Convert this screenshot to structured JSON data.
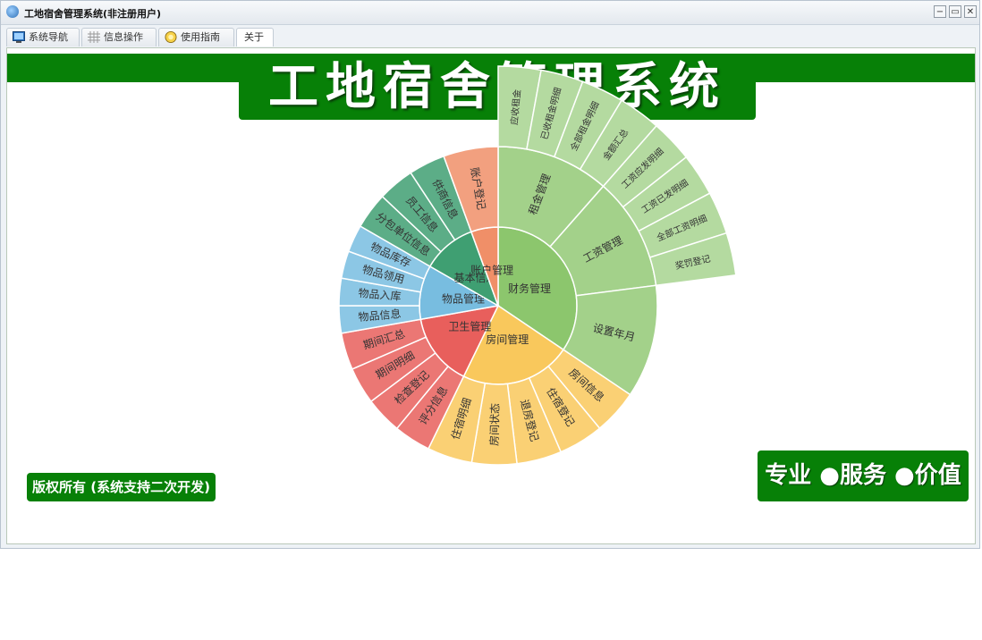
{
  "window": {
    "title": "工地宿舍管理系统(非注册用户)",
    "controls": {
      "minimize": "−",
      "restore": "▭",
      "close": "✕"
    }
  },
  "tabs": [
    {
      "label": "系统导航",
      "icon": "navigation-icon"
    },
    {
      "label": "信息操作",
      "icon": "grid-icon"
    },
    {
      "label": "使用指南",
      "icon": "guide-icon"
    },
    {
      "label": "关于",
      "icon": ""
    }
  ],
  "banner": {
    "title": "工地宿舍管理系统"
  },
  "footer": {
    "copyright": "版权所有 (系统支持二次开发)",
    "slogan": "专业 ●服务 ●价值"
  },
  "colors": {
    "brand_green": "#078007",
    "finance": "#8cc66d",
    "rooms": "#f9c85c",
    "hygiene": "#e85f5c",
    "goods": "#78bde0",
    "basic": "#3f9f72",
    "account": "#f08f68"
  },
  "menu_tree": [
    {
      "label": "财务管理",
      "color": "#8cc66d",
      "children": [
        {
          "label": "租金管理",
          "children": [
            "应收租金",
            "已收租金明细",
            "全部租金明细",
            "金额汇总"
          ]
        },
        {
          "label": "工资管理",
          "children": [
            "工资应发明细",
            "工资已发明细",
            "全部工资明细",
            "奖罚登记"
          ]
        },
        {
          "label": "设置年月",
          "children": []
        }
      ]
    },
    {
      "label": "房间管理",
      "color": "#f9c85c",
      "children": [
        {
          "label": "房间信息",
          "children": []
        },
        {
          "label": "住宿登记",
          "children": []
        },
        {
          "label": "退房登记",
          "children": []
        },
        {
          "label": "房间状态",
          "children": []
        },
        {
          "label": "住宿明细",
          "children": []
        }
      ]
    },
    {
      "label": "卫生管理",
      "color": "#e85f5c",
      "children": [
        {
          "label": "评分信息",
          "children": []
        },
        {
          "label": "检查登记",
          "children": []
        },
        {
          "label": "期间明细",
          "children": []
        },
        {
          "label": "期间汇总",
          "children": []
        }
      ]
    },
    {
      "label": "物品管理",
      "color": "#78bde0",
      "children": [
        {
          "label": "物品信息",
          "children": []
        },
        {
          "label": "物品入库",
          "children": []
        },
        {
          "label": "物品领用",
          "children": []
        },
        {
          "label": "物品库存",
          "children": []
        }
      ]
    },
    {
      "label": "基本信息",
      "color": "#3f9f72",
      "children": [
        {
          "label": "分包单位信息",
          "children": []
        },
        {
          "label": "员工信息",
          "children": []
        },
        {
          "label": "供商信息",
          "children": []
        }
      ]
    },
    {
      "label": "账户管理",
      "color": "#f08f68",
      "children": [
        {
          "label": "账户登记",
          "children": []
        }
      ]
    }
  ]
}
